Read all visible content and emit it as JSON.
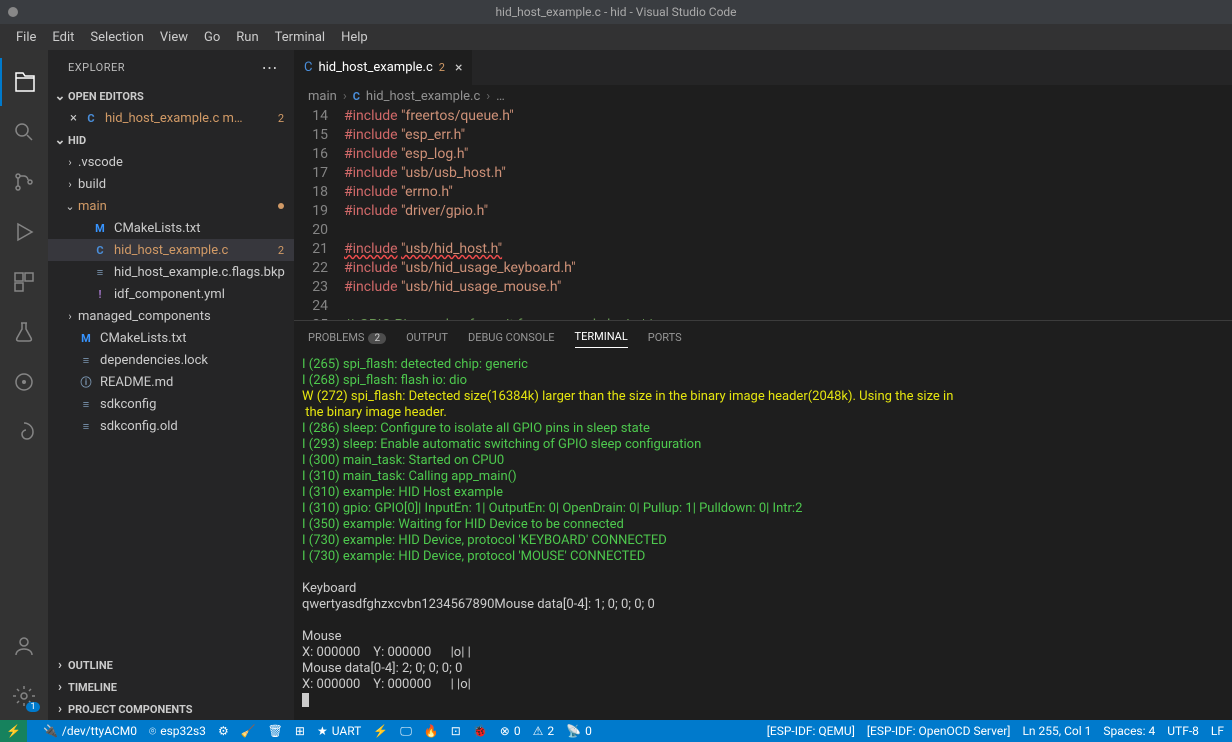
{
  "title": "hid_host_example.c - hid - Visual Studio Code",
  "menu": [
    "File",
    "Edit",
    "Selection",
    "View",
    "Go",
    "Run",
    "Terminal",
    "Help"
  ],
  "explorer": {
    "title": "EXPLORER",
    "openEditors": "OPEN EDITORS",
    "openFile": {
      "name": "hid_host_example.c m…",
      "badge": "2"
    },
    "project": "HID",
    "tree": [
      {
        "type": "folder",
        "chev": "›",
        "name": ".vscode"
      },
      {
        "type": "folder",
        "chev": "›",
        "name": "build"
      },
      {
        "type": "folder",
        "chev": "⌄",
        "name": "main",
        "mod": true
      },
      {
        "type": "file",
        "icon": "M",
        "cls": "fi-m",
        "name": "CMakeLists.txt",
        "indent": 1
      },
      {
        "type": "file",
        "icon": "C",
        "cls": "fi-c",
        "name": "hid_host_example.c",
        "indent": 1,
        "badge": "2",
        "sel": true,
        "mod": true
      },
      {
        "type": "file",
        "icon": "≡",
        "cls": "fi-doc",
        "name": "hid_host_example.c.flags.bkp",
        "indent": 1
      },
      {
        "type": "file",
        "icon": "!",
        "cls": "fi-cfg",
        "name": "idf_component.yml",
        "indent": 1
      },
      {
        "type": "folder",
        "chev": "›",
        "name": "managed_components"
      },
      {
        "type": "file",
        "icon": "M",
        "cls": "fi-m",
        "name": "CMakeLists.txt"
      },
      {
        "type": "file",
        "icon": "≡",
        "cls": "fi-doc",
        "name": "dependencies.lock"
      },
      {
        "type": "file",
        "icon": "ⓘ",
        "cls": "fi-info",
        "name": "README.md"
      },
      {
        "type": "file",
        "icon": "≡",
        "cls": "fi-doc",
        "name": "sdkconfig"
      },
      {
        "type": "file",
        "icon": "≡",
        "cls": "fi-doc",
        "name": "sdkconfig.old"
      }
    ],
    "outline": "OUTLINE",
    "timeline": "TIMELINE",
    "projectComp": "PROJECT COMPONENTS"
  },
  "tab": {
    "name": "hid_host_example.c",
    "badge": "2"
  },
  "breadcrumb": {
    "a": "main",
    "b": "hid_host_example.c",
    "c": "…"
  },
  "code": {
    "start": 14,
    "lines": [
      {
        "t": "inc",
        "h": "\"freertos/queue.h\""
      },
      {
        "t": "inc",
        "h": "\"esp_err.h\""
      },
      {
        "t": "inc",
        "h": "\"esp_log.h\""
      },
      {
        "t": "inc",
        "h": "\"usb/usb_host.h\""
      },
      {
        "t": "inc",
        "h": "\"errno.h\""
      },
      {
        "t": "inc",
        "h": "\"driver/gpio.h\""
      },
      {
        "t": "blank"
      },
      {
        "t": "incw",
        "h": "\"usb/hid_host.h\""
      },
      {
        "t": "inc",
        "h": "\"usb/hid_usage_keyboard.h\""
      },
      {
        "t": "inc",
        "h": "\"usb/hid_usage_mouse.h\""
      },
      {
        "t": "blank"
      },
      {
        "t": "com",
        "c": "/* GPIO Pin number for quit from example logic */"
      }
    ]
  },
  "panel": {
    "problems": "PROBLEMS",
    "pcount": "2",
    "output": "OUTPUT",
    "dbg": "DEBUG CONSOLE",
    "terminal": "TERMINAL",
    "ports": "PORTS"
  },
  "term": [
    {
      "c": "g",
      "t": "I (265) spi_flash: detected chip: generic"
    },
    {
      "c": "g",
      "t": "I (268) spi_flash: flash io: dio"
    },
    {
      "c": "y",
      "t": "W (272) spi_flash: Detected size(16384k) larger than the size in the binary image header(2048k). Using the size in"
    },
    {
      "c": "y",
      "t": " the binary image header."
    },
    {
      "c": "g",
      "t": "I (286) sleep: Configure to isolate all GPIO pins in sleep state"
    },
    {
      "c": "g",
      "t": "I (293) sleep: Enable automatic switching of GPIO sleep configuration"
    },
    {
      "c": "g",
      "t": "I (300) main_task: Started on CPU0"
    },
    {
      "c": "g",
      "t": "I (310) main_task: Calling app_main()"
    },
    {
      "c": "g",
      "t": "I (310) example: HID Host example"
    },
    {
      "c": "g",
      "t": "I (310) gpio: GPIO[0]| InputEn: 1| OutputEn: 0| OpenDrain: 0| Pullup: 1| Pulldown: 0| Intr:2"
    },
    {
      "c": "g",
      "t": "I (350) example: Waiting for HID Device to be connected"
    },
    {
      "c": "g",
      "t": "I (730) example: HID Device, protocol 'KEYBOARD' CONNECTED"
    },
    {
      "c": "g",
      "t": "I (730) example: HID Device, protocol 'MOUSE' CONNECTED"
    },
    {
      "c": "w",
      "t": ""
    },
    {
      "c": "w",
      "t": "Keyboard"
    },
    {
      "c": "w",
      "t": "qwertyasdfghzxcvbn1234567890Mouse data[0-4]: 1; 0; 0; 0; 0"
    },
    {
      "c": "w",
      "t": ""
    },
    {
      "c": "w",
      "t": "Mouse"
    },
    {
      "c": "w",
      "t": "X: 000000    Y: 000000      |o| |"
    },
    {
      "c": "w",
      "t": "Mouse data[0-4]: 2; 0; 0; 0; 0"
    },
    {
      "c": "w",
      "t": "X: 000000    Y: 000000      | |o|"
    }
  ],
  "status": {
    "port": "/dev/ttyACM0",
    "chip": "esp32s3",
    "uart": "UART",
    "errs": "0",
    "warns": "2",
    "radio": "0",
    "qemu": "[ESP-IDF: QEMU]",
    "ocd": "[ESP-IDF: OpenOCD Server]",
    "pos": "Ln 255, Col 1",
    "spaces": "Spaces: 4",
    "enc": "UTF-8",
    "eol": "LF"
  }
}
